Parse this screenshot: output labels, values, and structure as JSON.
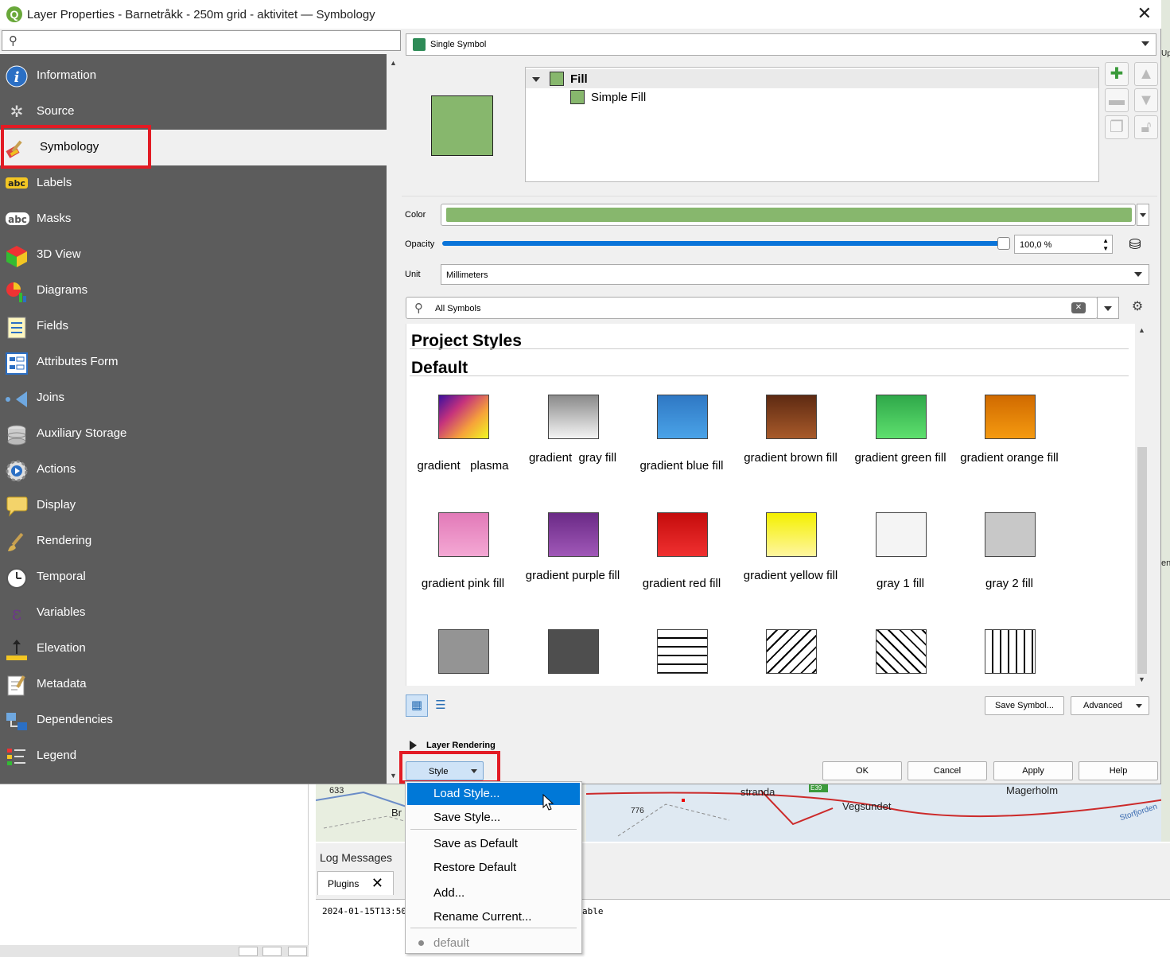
{
  "window": {
    "title": "Layer Properties - Barnetråkk - 250m grid - aktivitet — Symbology",
    "close_glyph": "✕"
  },
  "sidebar": {
    "search_placeholder": "",
    "items": [
      {
        "label": "Information",
        "icon": "info-icon"
      },
      {
        "label": "Source",
        "icon": "source-icon"
      },
      {
        "label": "Symbology",
        "icon": "symbology-brush-icon"
      },
      {
        "label": "Labels",
        "icon": "labels-icon"
      },
      {
        "label": "Masks",
        "icon": "masks-icon"
      },
      {
        "label": "3D View",
        "icon": "3d-cube-icon"
      },
      {
        "label": "Diagrams",
        "icon": "diagrams-icon"
      },
      {
        "label": "Fields",
        "icon": "fields-icon"
      },
      {
        "label": "Attributes Form",
        "icon": "form-icon"
      },
      {
        "label": "Joins",
        "icon": "joins-icon"
      },
      {
        "label": "Auxiliary Storage",
        "icon": "database-icon"
      },
      {
        "label": "Actions",
        "icon": "actions-gear-icon"
      },
      {
        "label": "Display",
        "icon": "speech-bubble-icon"
      },
      {
        "label": "Rendering",
        "icon": "paintbrush-icon"
      },
      {
        "label": "Temporal",
        "icon": "clock-icon"
      },
      {
        "label": "Variables",
        "icon": "epsilon-icon"
      },
      {
        "label": "Elevation",
        "icon": "elevation-icon"
      },
      {
        "label": "Metadata",
        "icon": "metadata-icon"
      },
      {
        "label": "Dependencies",
        "icon": "dependencies-icon"
      },
      {
        "label": "Legend",
        "icon": "legend-icon"
      }
    ]
  },
  "symbology": {
    "renderer": "Single Symbol",
    "tree": {
      "root": "Fill",
      "child": "Simple Fill"
    },
    "color_label": "Color",
    "color_value": "#87b76d",
    "opacity_label": "Opacity",
    "opacity_value": "100,0 %",
    "opacity_fraction": 1.0,
    "unit_label": "Unit",
    "unit_value": "Millimeters",
    "symbol_filter": "All Symbols",
    "groups": [
      "Project Styles",
      "Default"
    ],
    "symbols": [
      {
        "name": "gradient   plasma",
        "fill": "linear-gradient(135deg,#3b0f9e,#c5327c,#f6a23a,#f0f921)"
      },
      {
        "name": "gradient  gray fill",
        "fill": "linear-gradient(180deg,#8a8a8a,#f4f4f4)"
      },
      {
        "name": "gradient blue fill",
        "fill": "linear-gradient(180deg,#2f78c4,#4aa3e8)"
      },
      {
        "name": "gradient brown fill",
        "fill": "linear-gradient(180deg,#5e2a12,#a85a2a)"
      },
      {
        "name": "gradient green fill",
        "fill": "linear-gradient(180deg,#2fa84a,#5ee06e)"
      },
      {
        "name": "gradient orange fill",
        "fill": "linear-gradient(180deg,#d06a00,#f59a10)"
      },
      {
        "name": "gradient pink fill",
        "fill": "linear-gradient(180deg,#e27ab8,#f4a8d4)"
      },
      {
        "name": "gradient purple fill",
        "fill": "linear-gradient(180deg,#6a2a86,#a058b8)"
      },
      {
        "name": "gradient red fill",
        "fill": "linear-gradient(180deg,#c40c0c,#f03030)"
      },
      {
        "name": "gradient yellow fill",
        "fill": "linear-gradient(180deg,#f4f000,#fff6a0)"
      },
      {
        "name": "gray 1 fill",
        "fill": "#f4f4f4"
      },
      {
        "name": "gray 2 fill",
        "fill": "#c8c8c8"
      },
      {
        "name": "",
        "fill": "#949494"
      },
      {
        "name": "",
        "fill": "#4e4e4e"
      },
      {
        "name": "",
        "fill": "repeating-linear-gradient(180deg,#fff 0 9px,#000 9px 11px)"
      },
      {
        "name": "",
        "fill": "repeating-linear-gradient(135deg,#fff 0 8px,#000 8px 10px)"
      },
      {
        "name": "",
        "fill": "repeating-linear-gradient(45deg,#fff 0 8px,#000 8px 10px)"
      },
      {
        "name": "",
        "fill": "repeating-linear-gradient(90deg,#fff 0 8px,#000 8px 10px)"
      }
    ],
    "save_symbol": "Save Symbol...",
    "advanced": "Advanced",
    "layer_rendering": "Layer Rendering"
  },
  "buttons": {
    "style": "Style",
    "ok": "OK",
    "cancel": "Cancel",
    "apply": "Apply",
    "help": "Help"
  },
  "style_menu": {
    "items": [
      "Load Style...",
      "Save Style...",
      "Save as Default",
      "Restore Default",
      "Add...",
      "Rename Current...",
      "default"
    ]
  },
  "background": {
    "map_labels": [
      "633",
      "Br",
      "stranda",
      "E39",
      "776",
      "Vegsundet",
      "Magerholm",
      "Storfjorden",
      "Up",
      "en"
    ],
    "log_title": "Log Messages",
    "log_tab": "Plugins",
    "log_timestamp": "2024-01-15T13:50:4",
    "log_tail": "able"
  },
  "colors": {
    "highlight_red": "#e21b24",
    "menu_highlight": "#0078d7",
    "nav_bg": "#5c5c5c"
  }
}
